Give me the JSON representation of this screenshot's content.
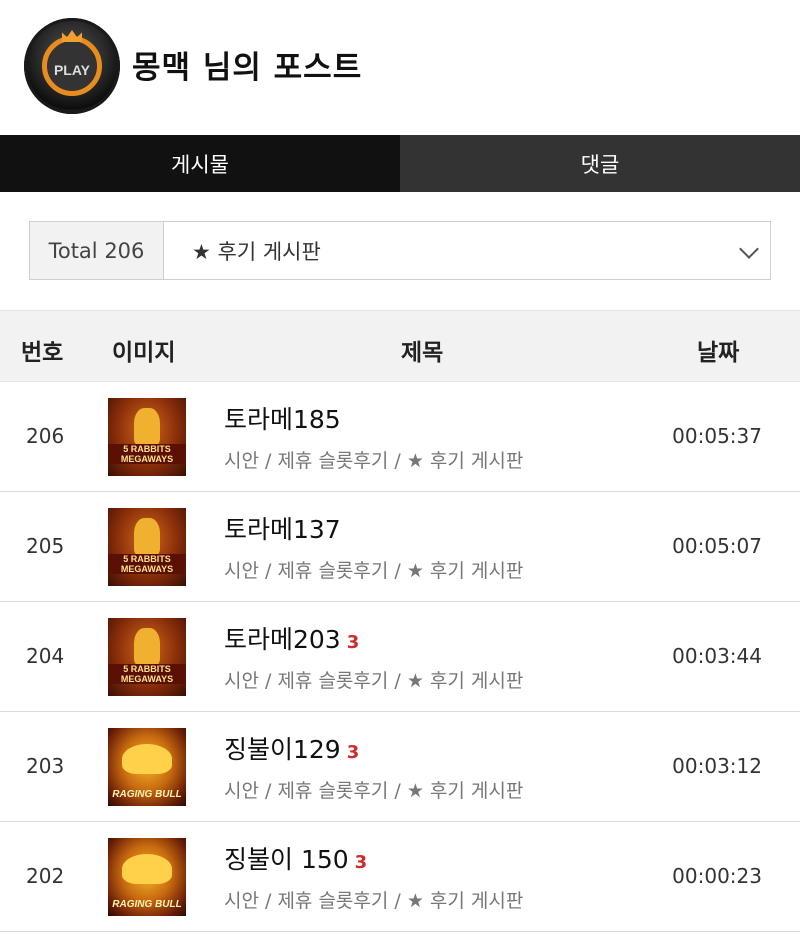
{
  "header": {
    "title": "몽맥 님의 포스트",
    "avatar_text": "PLAY"
  },
  "tabs": [
    {
      "label": "게시물",
      "active": true
    },
    {
      "label": "댓글",
      "active": false
    }
  ],
  "filter": {
    "total": "Total 206",
    "selected": "★ 후기 게시판"
  },
  "table": {
    "headers": {
      "num": "번호",
      "image": "이미지",
      "title": "제목",
      "date": "날짜"
    },
    "rows": [
      {
        "num": "206",
        "thumb": "5 RABBITS MEGAWAYS",
        "title": "토라메185",
        "count": "",
        "meta": "시안 / 제휴 슬롯후기 / ★ 후기 게시판",
        "time": "00:05:37"
      },
      {
        "num": "205",
        "thumb": "5 RABBITS MEGAWAYS",
        "title": "토라메137",
        "count": "",
        "meta": "시안 / 제휴 슬롯후기 / ★ 후기 게시판",
        "time": "00:05:07"
      },
      {
        "num": "204",
        "thumb": "5 RABBITS MEGAWAYS",
        "title": "토라메203",
        "count": "3",
        "meta": "시안 / 제휴 슬롯후기 / ★ 후기 게시판",
        "time": "00:03:44"
      },
      {
        "num": "203",
        "thumb": "RAGING BULL",
        "title": "징불이129",
        "count": "3",
        "meta": "시안 / 제휴 슬롯후기 / ★ 후기 게시판",
        "time": "00:03:12"
      },
      {
        "num": "202",
        "thumb": "RAGING BULL",
        "title": "징불이 150",
        "count": "3",
        "meta": "시안 / 제휴 슬롯후기 / ★ 후기 게시판",
        "time": "00:00:23"
      }
    ]
  },
  "colors": {
    "tab_active": "#111111",
    "tab_inactive": "#333333",
    "comment_count": "#d12a2a"
  }
}
